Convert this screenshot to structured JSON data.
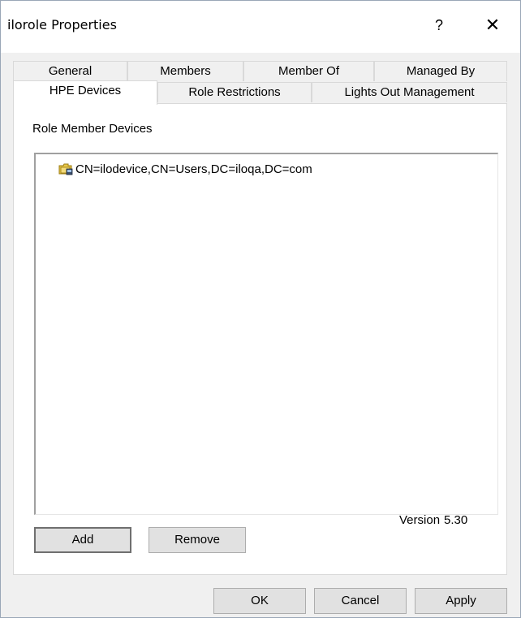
{
  "window": {
    "title": "ilorole Properties",
    "help_label": "?",
    "close_label": "✕"
  },
  "tabs": {
    "back_row": [
      {
        "label": "General"
      },
      {
        "label": "Members"
      },
      {
        "label": "Member Of"
      },
      {
        "label": "Managed By"
      }
    ],
    "front_row": [
      {
        "label": "HPE Devices",
        "selected": true
      },
      {
        "label": "Role Restrictions"
      },
      {
        "label": "Lights Out Management"
      }
    ]
  },
  "panel": {
    "section_label": "Role Member Devices",
    "devices": [
      {
        "name": "CN=ilodevice,CN=Users,DC=iloqa,DC=com",
        "icon": "folder-device-icon"
      }
    ],
    "add_label": "Add",
    "remove_label": "Remove",
    "version_label": "Version",
    "version_value": "5.30"
  },
  "footer": {
    "ok_label": "OK",
    "cancel_label": "Cancel",
    "apply_label": "Apply"
  },
  "colors": {
    "window_bg": "#f0f0f0",
    "panel_bg": "#ffffff",
    "button_bg": "#e1e1e1",
    "button_border": "#adadad"
  }
}
